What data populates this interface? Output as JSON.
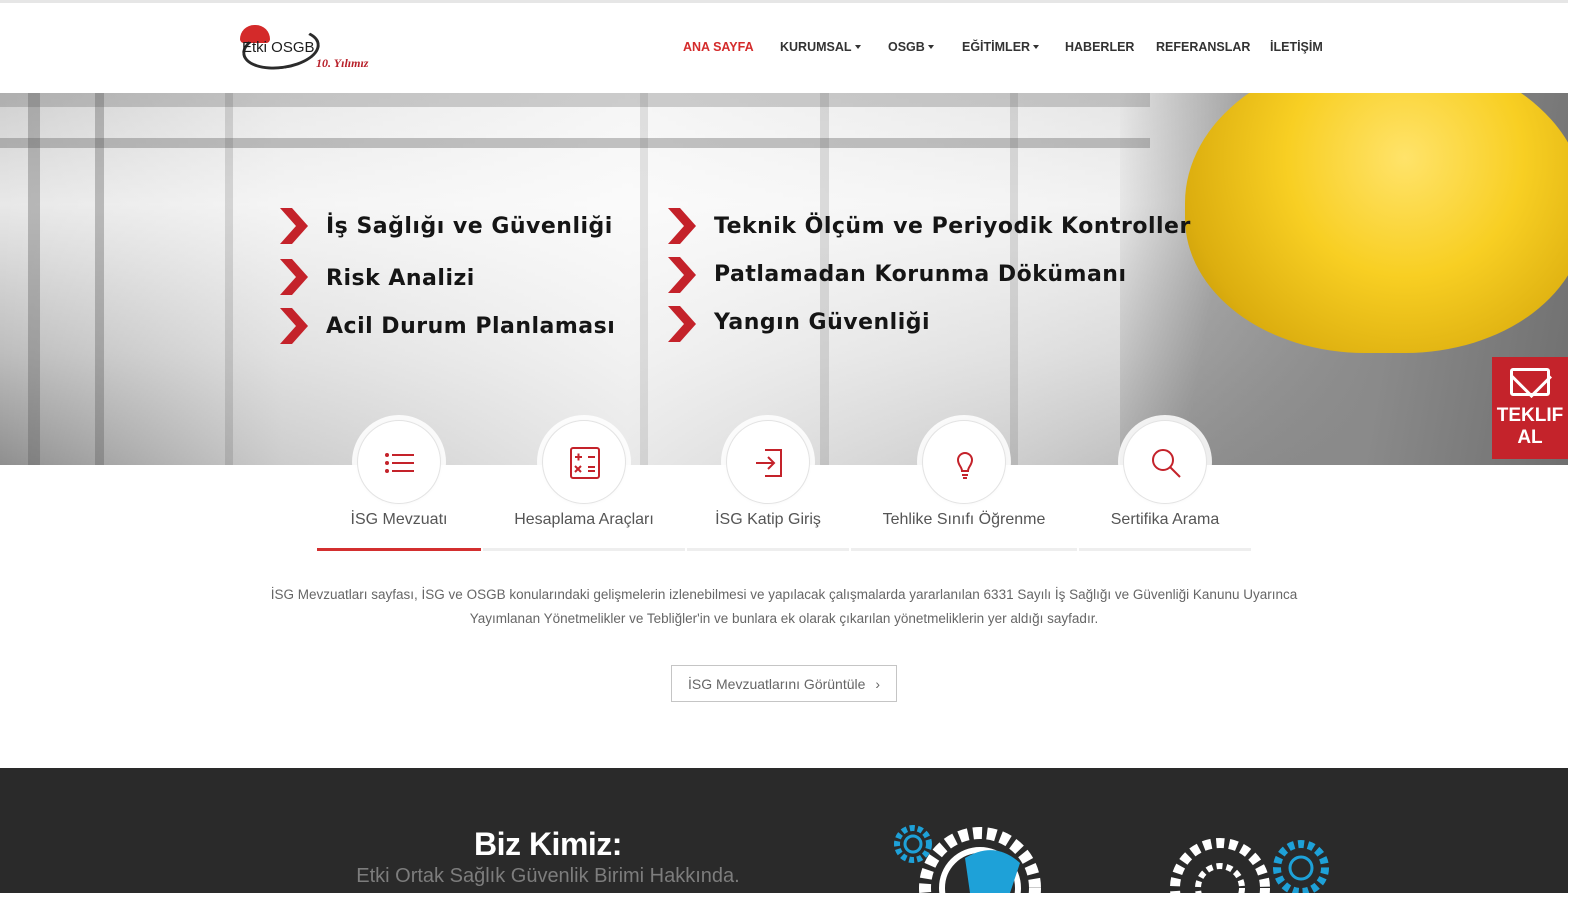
{
  "header": {
    "logo": {
      "brand": "Etki OSGB",
      "anniversary": "10. Yılımız"
    },
    "nav": [
      {
        "label": "ANA SAYFA",
        "active": true,
        "dropdown": false
      },
      {
        "label": "KURUMSAL",
        "active": false,
        "dropdown": true
      },
      {
        "label": "OSGB",
        "active": false,
        "dropdown": true
      },
      {
        "label": "EĞİTİMLER",
        "active": false,
        "dropdown": true
      },
      {
        "label": "HABERLER",
        "active": false,
        "dropdown": false
      },
      {
        "label": "REFERANSLAR",
        "active": false,
        "dropdown": false
      },
      {
        "label": "İLETİŞİM",
        "active": false,
        "dropdown": false
      }
    ]
  },
  "hero": {
    "services_left": [
      "İş Sağlığı ve Güvenliği",
      "Risk Analizi",
      "Acil Durum Planlaması"
    ],
    "services_right": [
      "Teknik Ölçüm ve Periyodik Kontroller",
      "Patlamadan Korunma Dökümanı",
      "Yangın Güvenliği"
    ]
  },
  "teklif": {
    "label_line1": "TEKLIF",
    "label_line2": "AL",
    "icon": "mail-icon"
  },
  "tabs": [
    {
      "label": "İSG Mevzuatı",
      "icon": "list-icon",
      "active": true
    },
    {
      "label": "Hesaplama Araçları",
      "icon": "calculator-icon",
      "active": false
    },
    {
      "label": "İSG Katip Giriş",
      "icon": "login-icon",
      "active": false
    },
    {
      "label": "Tehlike Sınıfı Öğrenme",
      "icon": "lightbulb-icon",
      "active": false
    },
    {
      "label": "Sertifika Arama",
      "icon": "search-icon",
      "active": false
    }
  ],
  "content": {
    "description_line1": "İSG Mevzuatları sayfası, İSG ve OSGB konularındaki gelişmelerin izlenebilmesi ve yapılacak çalışmalarda yararlanılan 6331 Sayılı İş Sağlığı ve Güvenliği Kanunu Uyarınca",
    "description_line2": "Yayımlanan Yönetmelikler ve Tebliğler'in ve bunlara ek olarak çıkarılan yönetmeliklerin yer aldığı sayfadır.",
    "button_label": "İSG Mevzuatlarını Görüntüle"
  },
  "about": {
    "title": "Biz Kimiz:",
    "subtitle": "Etki Ortak Sağlık Güvenlik Birimi Hakkında."
  },
  "colors": {
    "accent": "#d32f2f",
    "teklif_bg": "#c4232b",
    "dark_bg": "#2a2a2a",
    "gear_blue": "#1ea1d8"
  }
}
